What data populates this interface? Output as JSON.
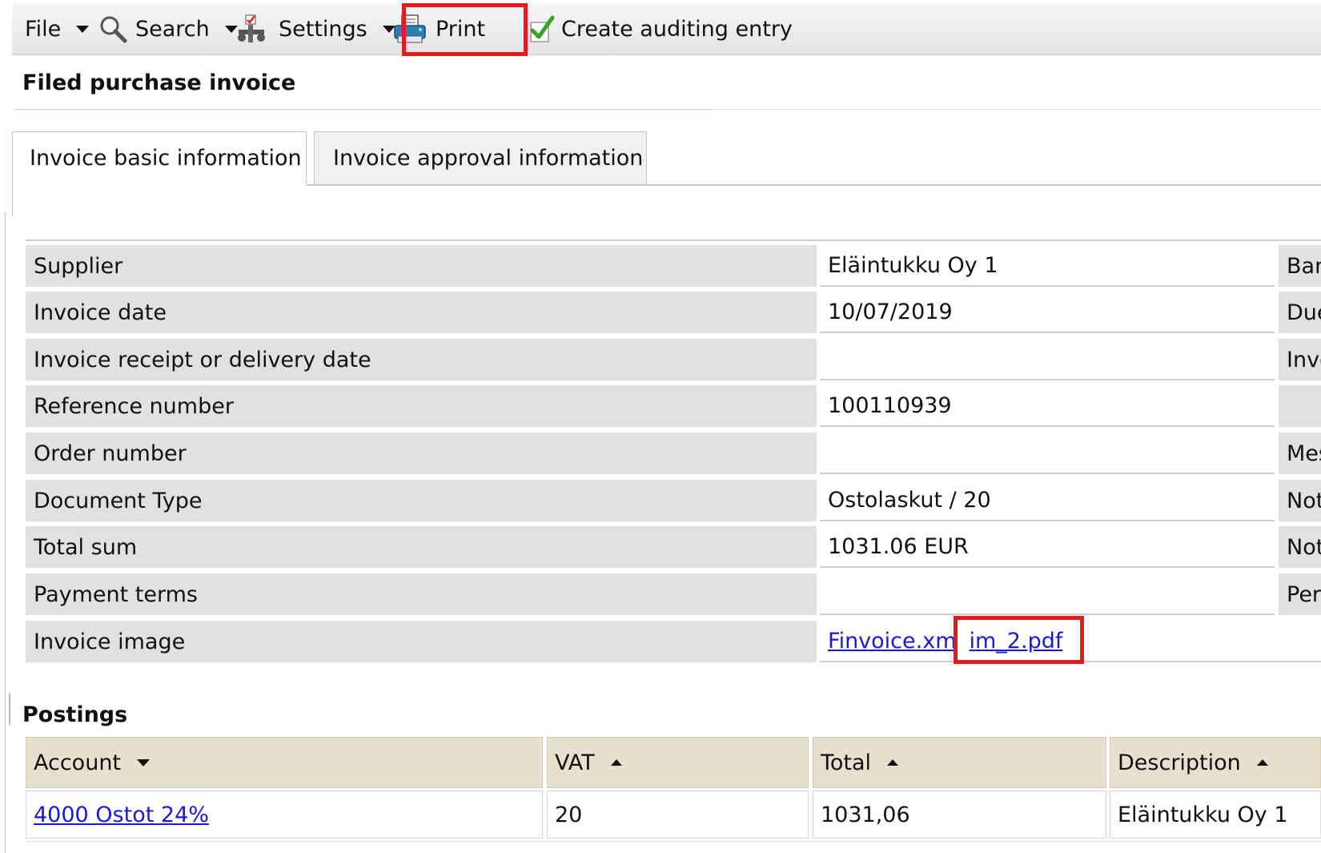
{
  "toolbar": {
    "file_label": "File",
    "search_label": "Search",
    "settings_label": "Settings",
    "print_label": "Print",
    "audit_label": "Create auditing entry"
  },
  "page": {
    "title": "Filed purchase invoice",
    "title_suffix": "."
  },
  "tabs": {
    "basic": "Invoice basic information",
    "approval": "Invoice approval information"
  },
  "details": {
    "rows": [
      {
        "label": "Supplier",
        "value": "Eläintukku Oy  1",
        "right": "Ban"
      },
      {
        "label": "Invoice date",
        "value": "10/07/2019",
        "right": "Due"
      },
      {
        "label": "Invoice receipt or delivery date",
        "value": "",
        "right": "Invo"
      },
      {
        "label": "Reference number",
        "value": "100110939",
        "right": ""
      },
      {
        "label": "Order number",
        "value": "",
        "right": "Mes"
      },
      {
        "label": "Document Type",
        "value": "Ostolaskut / 20",
        "right": "Not"
      },
      {
        "label": "Total sum",
        "value": "1031.06 EUR",
        "right": "Not"
      },
      {
        "label": "Payment terms",
        "value": "",
        "right": "Peri"
      }
    ],
    "image_label": "Invoice image",
    "image_links": [
      "Finvoice.xm",
      "im_2.pdf"
    ]
  },
  "postings": {
    "title": "Postings",
    "columns": [
      "Account",
      "VAT",
      "Total",
      "Description"
    ],
    "rows": [
      {
        "account": "4000 Ostot 24%",
        "vat": "20",
        "total": "1031,06",
        "description": "Eläintukku Oy 1"
      }
    ]
  },
  "colors": {
    "highlight": "#e31b1b",
    "link": "#1a1ad6",
    "label_bg": "#e1e1e1",
    "header_bg": "#e8e0cf"
  }
}
